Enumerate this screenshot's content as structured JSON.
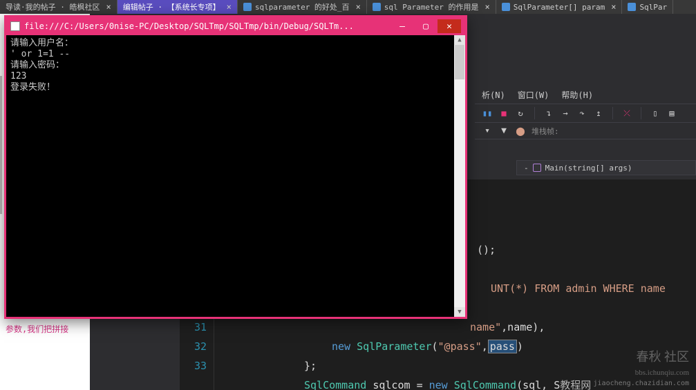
{
  "tabs": {
    "t0": "导读·我的帖子 · 皓枫社区",
    "t1": "编辑帖子 · 【系统长专项】",
    "t2": "sqlparameter 的好处_百",
    "t3": "sql Parameter 的作用是",
    "t4": "SqlParameter[] param",
    "t5": "SqlPar"
  },
  "menu": {
    "analyze": "析(N)",
    "window": "窗口(W)",
    "help": "帮助(H)"
  },
  "debug_bar": {
    "stack_label": "堆栈帧:"
  },
  "breadcrumb": {
    "method": "Main(string[] args)"
  },
  "console": {
    "title": "file:///C:/Users/0nise-PC/Desktop/SQLTmp/SQLTmp/bin/Debug/SQLTm...",
    "line1": "请输入用户名：",
    "line2": "' or 1=1 --",
    "line3": "请输入密码：",
    "line4": "123",
    "line5": "登录失败！"
  },
  "code": {
    "ln31": "31",
    "ln32": "32",
    "ln33": "33",
    "frag_parens": "();",
    "frag_unt": "UNT(*) FROM admin WHERE name ",
    "frag_name1": "name\"",
    "frag_name2": ",name),",
    "kw_new": "new",
    "type_sqlparam": "SqlParameter",
    "str_pass": "\"@pass\"",
    "var_pass": "pass",
    "close1": ")",
    "brace": "};",
    "type_sqlcmd": "SqlCommand",
    "var_sqlcom": "sqlcom",
    "eq": "=",
    "frag_cmdargs": "(sql, S",
    "partial_suffix": "教程网"
  },
  "left_text": "参数,我们把拼接",
  "watermark": {
    "main": "春秋 社区",
    "sub": "bbs.ichunqiu.com",
    "footer": "jiaocheng.chazidian.com"
  }
}
